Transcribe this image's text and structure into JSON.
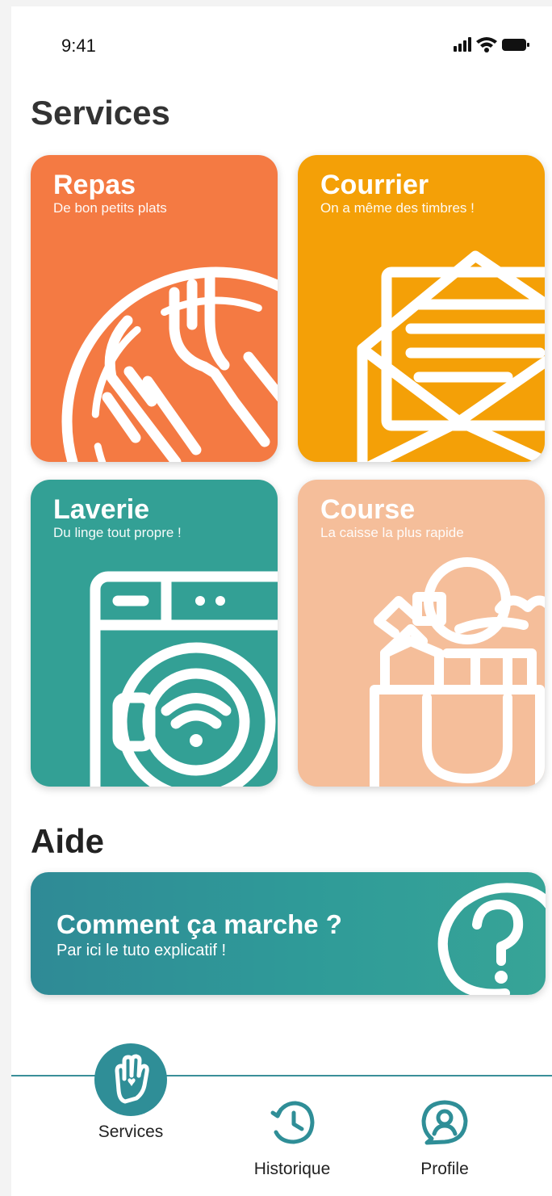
{
  "status": {
    "time": "9:41"
  },
  "sections": {
    "services": "Services",
    "help": "Aide"
  },
  "cards": [
    {
      "title": "Repas",
      "subtitle": "De bon petits plats",
      "color": "#f47a43",
      "icon": "plate-fork-knife-icon"
    },
    {
      "title": "Courrier",
      "subtitle": "On a même des timbres !",
      "color": "#f4a007",
      "icon": "envelope-letter-icon"
    },
    {
      "title": "Laverie",
      "subtitle": "Du linge tout propre !",
      "color": "#33a095",
      "icon": "washing-machine-icon"
    },
    {
      "title": "Course",
      "subtitle": "La caisse la plus rapide",
      "color": "#f5be9a",
      "icon": "grocery-bag-icon"
    }
  ],
  "help_card": {
    "title": "Comment ça marche ?",
    "subtitle": "Par ici le tuto explicatif !",
    "icon": "question-mark-icon"
  },
  "tabs": [
    {
      "label": "Services",
      "icon": "hand-heart-icon",
      "active": true
    },
    {
      "label": "Historique",
      "icon": "history-clock-icon",
      "active": false
    },
    {
      "label": "Profile",
      "icon": "profile-chat-icon",
      "active": false
    }
  ],
  "colors": {
    "accent": "#2f8e97",
    "text_dark": "#333333"
  }
}
